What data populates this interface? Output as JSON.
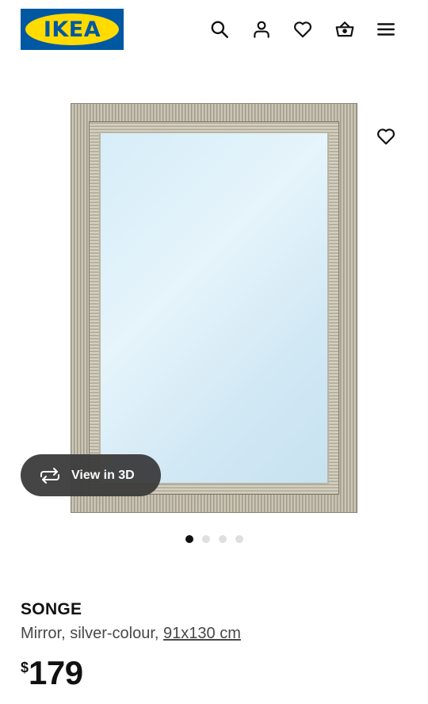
{
  "header": {
    "logo_text": "IKEA",
    "brand_colors": {
      "blue": "#0058a3",
      "yellow": "#ffdb00"
    },
    "icons": [
      "search-icon",
      "account-icon",
      "heart-icon",
      "shopping-bag-icon",
      "menu-icon"
    ]
  },
  "gallery": {
    "view_3d_label": "View in 3D",
    "slide_count": 4,
    "active_slide": 1,
    "favourite_icon": "heart-icon"
  },
  "product": {
    "name": "SONGE",
    "description": "Mirror, silver-colour,",
    "size": "91x130 cm",
    "price_currency": "$",
    "price_amount": "179"
  }
}
